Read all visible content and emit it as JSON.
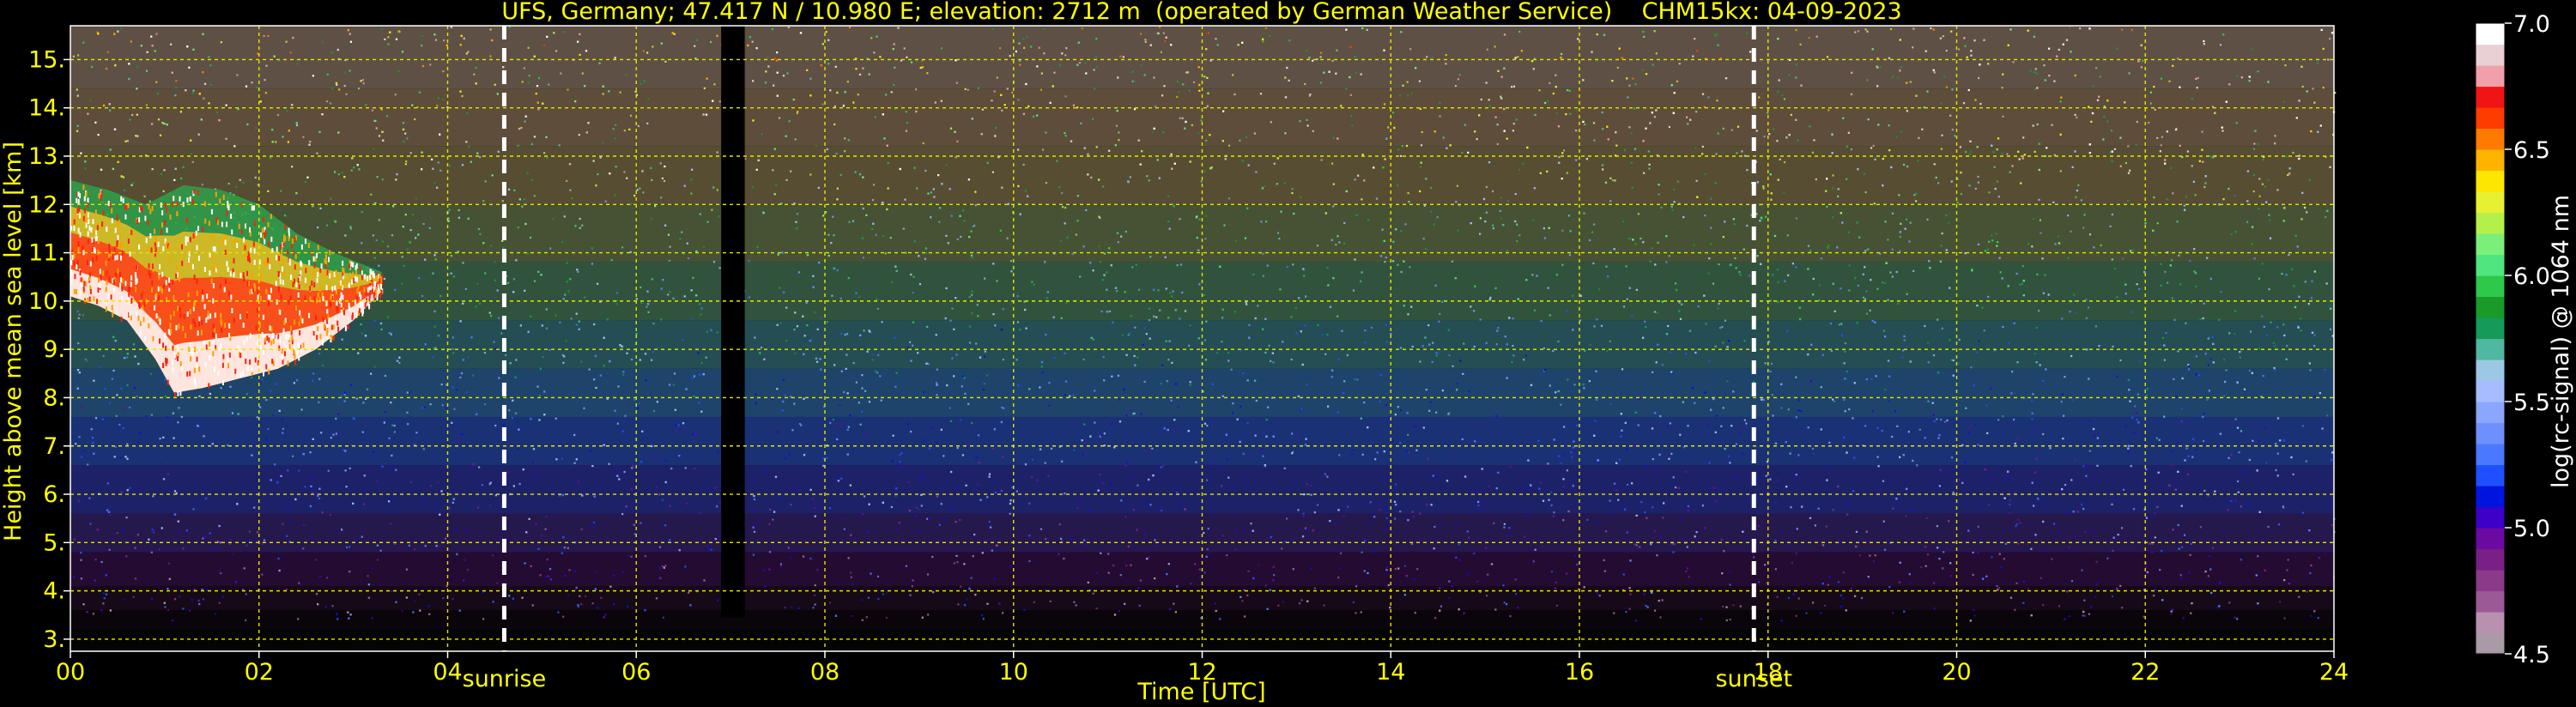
{
  "chart_data": {
    "type": "heatmap",
    "title": "UFS, Germany; 47.417 N / 10.980 E; elevation: 2712 m  (operated by German Weather Service)    CHM15kx: 04-09-2023",
    "xlabel": "Time [UTC]",
    "ylabel": "Height above mean sea level [km]",
    "xlim": [
      0,
      24
    ],
    "ylim": [
      2.75,
      15.7
    ],
    "x_ticks": [
      "00",
      "02",
      "04",
      "06",
      "08",
      "10",
      "12",
      "14",
      "16",
      "18",
      "20",
      "22",
      "24"
    ],
    "x_tick_values": [
      0,
      2,
      4,
      6,
      8,
      10,
      12,
      14,
      16,
      18,
      20,
      22,
      24
    ],
    "y_ticks": [
      "3.",
      "4.",
      "5.",
      "6.",
      "7.",
      "8.",
      "9.",
      "10.",
      "11.",
      "12.",
      "13.",
      "14.",
      "15."
    ],
    "y_tick_values": [
      3,
      4,
      5,
      6,
      7,
      8,
      9,
      10,
      11,
      12,
      13,
      14,
      15
    ],
    "grid": true,
    "events": [
      {
        "label": "sunrise",
        "time": 4.6
      },
      {
        "label": "sunset",
        "time": 17.85
      }
    ],
    "data_gaps": [
      [
        6.9,
        7.15
      ]
    ],
    "cloud_layer": {
      "description": "strong backscatter, cirrus cloud",
      "time_range": [
        0.0,
        3.3
      ],
      "base_km": [
        [
          0.0,
          10.1
        ],
        [
          0.3,
          9.9
        ],
        [
          0.6,
          9.6
        ],
        [
          0.9,
          8.8
        ],
        [
          1.1,
          8.1
        ],
        [
          1.4,
          8.2
        ],
        [
          1.8,
          8.4
        ],
        [
          2.2,
          8.6
        ],
        [
          2.6,
          9.0
        ],
        [
          3.0,
          9.6
        ],
        [
          3.3,
          10.2
        ]
      ],
      "top_km": [
        [
          0.0,
          12.5
        ],
        [
          0.4,
          12.3
        ],
        [
          0.8,
          12.0
        ],
        [
          1.2,
          12.4
        ],
        [
          1.6,
          12.3
        ],
        [
          2.0,
          12.0
        ],
        [
          2.4,
          11.4
        ],
        [
          2.8,
          11.0
        ],
        [
          3.3,
          10.6
        ]
      ]
    },
    "colorbar": {
      "label": "log(rc-signal) @ 1064 nm",
      "range": [
        4.5,
        7.0
      ],
      "ticks": [
        "4.5",
        "5.0",
        "5.5",
        "6.0",
        "6.5",
        "7.0"
      ],
      "tick_values": [
        4.5,
        5.0,
        5.5,
        6.0,
        6.5,
        7.0
      ],
      "colors": [
        "#a89aa6",
        "#b891b0",
        "#9b5a96",
        "#8a3a88",
        "#7a1f86",
        "#6a0aa0",
        "#3c00c8",
        "#0014e0",
        "#1e50ff",
        "#4a78ff",
        "#6e90ff",
        "#8aa6ff",
        "#a6bcff",
        "#9cc8e6",
        "#50b8a0",
        "#169a5a",
        "#1a9a28",
        "#2ec84a",
        "#4ee67e",
        "#7af07a",
        "#b4f04a",
        "#e8f032",
        "#ffe600",
        "#ffb400",
        "#ff7a00",
        "#ff3c00",
        "#f01414",
        "#f0a0a8",
        "#e8d0d4",
        "#ffffff"
      ]
    }
  }
}
